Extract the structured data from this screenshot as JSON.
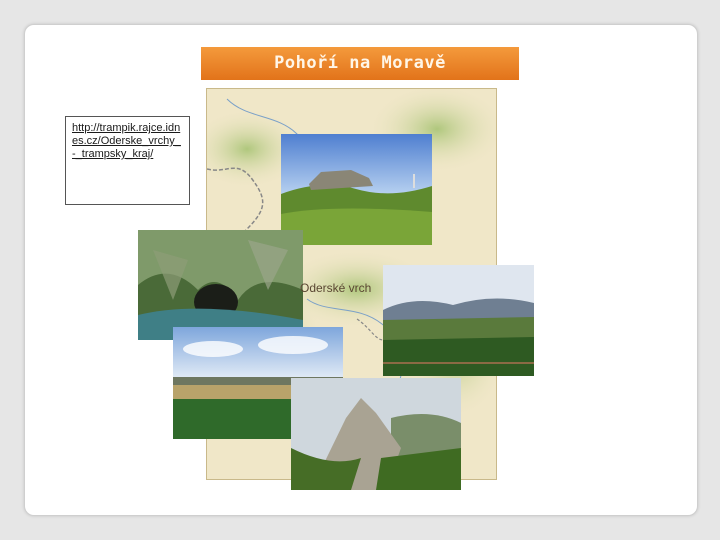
{
  "slide": {
    "title": "Pohoří na Moravě",
    "link_text": "http://trampik.rajce.idnes.cz/Oderske_vrchy_-_trampsky_kraj/",
    "map_label": "Oderské vrch"
  },
  "colors": {
    "title_bar": "#e98328",
    "title_text": "#fff6e8",
    "map_background": "#f0e7c8",
    "map_relief": "#b7c98a",
    "border_lines": "#7f7f7f"
  },
  "icons": [
    "map-figure",
    "photo-rock-meadow",
    "photo-cave-stream",
    "photo-hills-pasture",
    "photo-plain-field",
    "photo-rocky-ridge"
  ]
}
